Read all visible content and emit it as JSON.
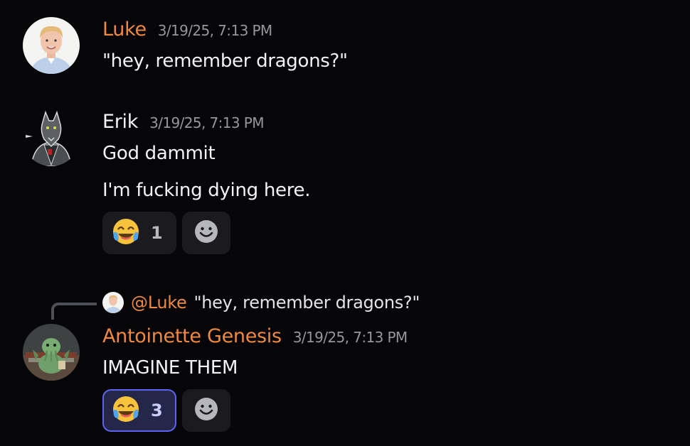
{
  "messages": [
    {
      "author": "Luke",
      "author_color": "#f0883e",
      "timestamp": "3/19/25, 7:13 PM",
      "lines": [
        "\"hey, remember dragons?\""
      ]
    },
    {
      "author": "Erik",
      "author_color": "#f2f3f5",
      "timestamp": "3/19/25, 7:13 PM",
      "lines": [
        "God dammit",
        "I'm fucking dying here."
      ],
      "reaction": {
        "emoji": "joy-emoji",
        "count": "1",
        "me": false
      }
    },
    {
      "reply": {
        "mention": "@Luke",
        "text": "\"hey, remember dragons?\""
      },
      "author": "Antoinette Genesis",
      "author_color": "#f0883e",
      "timestamp": "3/19/25, 7:13 PM",
      "lines": [
        "IMAGINE THEM"
      ],
      "reaction": {
        "emoji": "joy-emoji",
        "count": "3",
        "me": true
      }
    }
  ],
  "colors": {
    "background": "#060608",
    "accent": "#5a64f0",
    "timestamp": "#95969e"
  }
}
